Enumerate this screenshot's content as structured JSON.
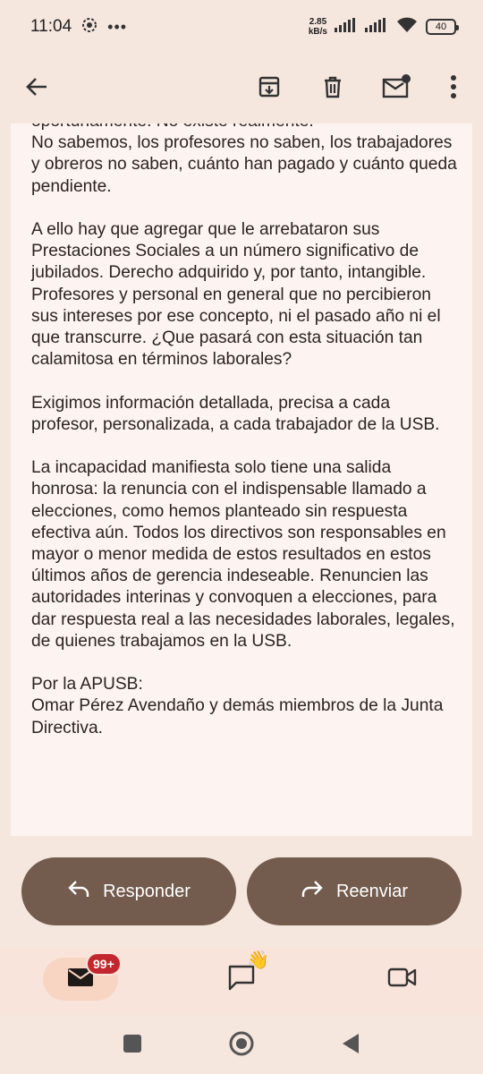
{
  "status_bar": {
    "time": "11:04",
    "speed_value": "2.85",
    "speed_unit": "kB/s",
    "battery": "40",
    "icons": [
      "signal-icon",
      "signal-icon",
      "wifi-icon",
      "battery-icon"
    ]
  },
  "toolbar": {
    "back": "back-arrow-icon",
    "archive": "archive-icon",
    "delete": "trash-icon",
    "mark_unread": "mark-unread-icon",
    "more": "more-vert-icon"
  },
  "message": {
    "paragraphs": [
      "oportunamente. No existe realmente.\nNo sabemos, los profesores no saben, los trabajadores y obreros no saben, cuánto han pagado y cuánto queda pendiente.",
      "A ello hay que agregar que le arrebataron sus Prestaciones Sociales a un número significativo de jubilados. Derecho adquirido y, por tanto, intangible. Profesores y personal en general que no percibieron sus intereses por ese concepto, ni el pasado año ni el que transcurre. ¿Que pasará con esta situación tan calamitosa en términos laborales?",
      "Exigimos información detallada, precisa a cada profesor, personalizada, a cada trabajador de la USB.",
      "La incapacidad manifiesta solo tiene una salida honrosa: la renuncia con el indispensable llamado a elecciones, como hemos planteado sin respuesta efectiva aún. Todos los directivos son responsables en mayor o menor medida  de estos resultados en estos últimos años de gerencia indeseable. Renuncien las autoridades interinas y convoquen a elecciones, para dar respuesta real a las necesidades laborales, legales, de quienes trabajamos en la USB.",
      "Por la APUSB:\nOmar Pérez Avendaño y demás miembros de la Junta Directiva."
    ]
  },
  "actions": {
    "reply_label": "Responder",
    "forward_label": "Reenviar"
  },
  "bottom_nav": {
    "mail_badge": "99+",
    "chat_emoji": "👋"
  },
  "colors": {
    "background": "#f5e6de",
    "content_bg": "#fdf4f1",
    "button_bg": "#735b4e",
    "badge": "#c1272d"
  }
}
